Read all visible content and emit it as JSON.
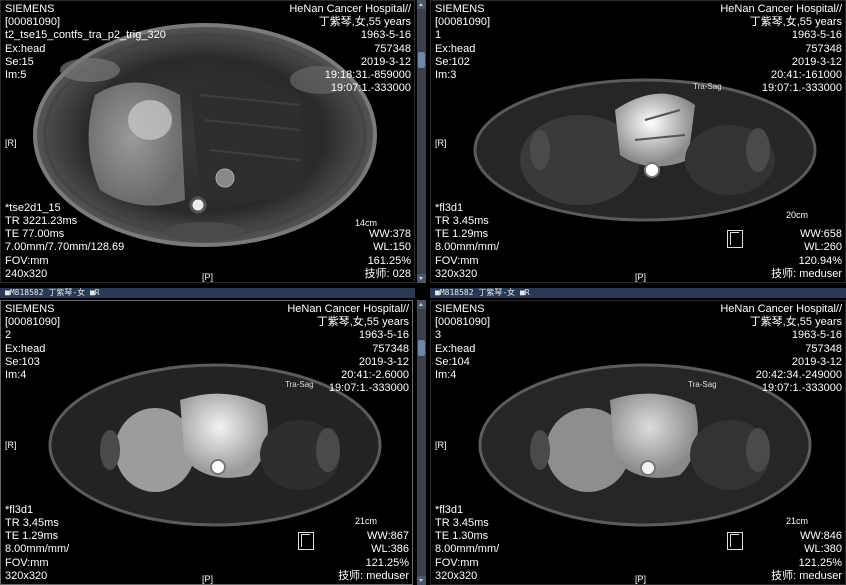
{
  "viewports": [
    {
      "top_left": [
        "SIEMENS",
        "[00081090]",
        "t2_tse15_contfs_tra_p2_trig_320",
        "Ex:head",
        "Se:15",
        "Im:5"
      ],
      "top_right": [
        "HeNan Cancer Hospital//",
        "丁紫琴,女,55 years",
        "1963-5-16",
        "757348",
        "2019-3-12",
        "19:18:31.-859000",
        "19:07:1.-333000"
      ],
      "bottom_left": [
        "*tse2d1_15",
        "TR 3221.23ms",
        "TE 77.00ms",
        "7.00mm/7.70mm/128.69",
        "FOV:mm",
        "240x320"
      ],
      "bottom_right": [
        "WW:378",
        "WL:150",
        "161.25%",
        "技师: 028"
      ],
      "left_marker": "[R]",
      "bottom_marker": "[P]",
      "scale_label": "14cm",
      "orientation_tag": ""
    },
    {
      "top_left": [
        "SIEMENS",
        "[00081090]",
        "1",
        "Ex:head",
        "Se:102",
        "Im:3"
      ],
      "top_right": [
        "HeNan Cancer Hospital//",
        "丁紫琴,女,55 years",
        "1963-5-16",
        "757348",
        "2019-3-12",
        "20:41:-161000",
        "19:07:1.-333000"
      ],
      "bottom_left": [
        "*fl3d1",
        "TR 3.45ms",
        "TE 1.29ms",
        "8.00mm/mm/",
        "FOV:mm",
        "320x320"
      ],
      "bottom_right": [
        "WW:658",
        "WL:260",
        "120.94%",
        "技师:  meduser"
      ],
      "left_marker": "[R]",
      "bottom_marker": "[P]",
      "scale_label": "20cm",
      "orientation_tag": "Tra-Sag"
    },
    {
      "top_left": [
        "SIEMENS",
        "[00081090]",
        "2",
        "Ex:head",
        "Se:103",
        "Im:4"
      ],
      "top_right": [
        "HeNan Cancer Hospital//",
        "丁紫琴,女,55 years",
        "1963-5-16",
        "757348",
        "2019-3-12",
        "20:41:-2.6000",
        "19:07:1.-333000"
      ],
      "bottom_left": [
        "*fl3d1",
        "TR 3.45ms",
        "TE 1.29ms",
        "8.00mm/mm/",
        "FOV:mm",
        "320x320"
      ],
      "bottom_right": [
        "WW:867",
        "WL:386",
        "121.25%",
        "技师:  meduser"
      ],
      "left_marker": "[R]",
      "bottom_marker": "[P]",
      "scale_label": "21cm",
      "orientation_tag": "Tra-Sag"
    },
    {
      "top_left": [
        "SIEMENS",
        "[00081090]",
        "3",
        "Ex:head",
        "Se:104",
        "Im:4"
      ],
      "top_right": [
        "HeNan Cancer Hospital//",
        "丁紫琴,女,55 years",
        "1963-5-16",
        "757348",
        "2019-3-12",
        "20:42:34.-249000",
        "19:07:1.-333000"
      ],
      "bottom_left": [
        "*fl3d1",
        "TR 3.45ms",
        "TE 1.30ms",
        "8.00mm/mm/",
        "FOV:mm",
        "320x320"
      ],
      "bottom_right": [
        "WW:846",
        "WL:380",
        "121.25%",
        "技师:  meduser"
      ],
      "left_marker": "[R]",
      "bottom_marker": "[P]",
      "scale_label": "21cm",
      "orientation_tag": "Tra-Sag"
    }
  ],
  "row_titles": [
    "■M818582 丁紫琴-女 ■R",
    "■M818582 丁紫琴-女 ■R"
  ],
  "colors": {
    "background": "#000000",
    "text": "#ffffff",
    "titlebar": "#2a3954",
    "scrollbar_thumb": "#6f86a8"
  },
  "icons": [
    "scroll-up-icon",
    "scroll-down-icon",
    "orientation-f-icon"
  ]
}
